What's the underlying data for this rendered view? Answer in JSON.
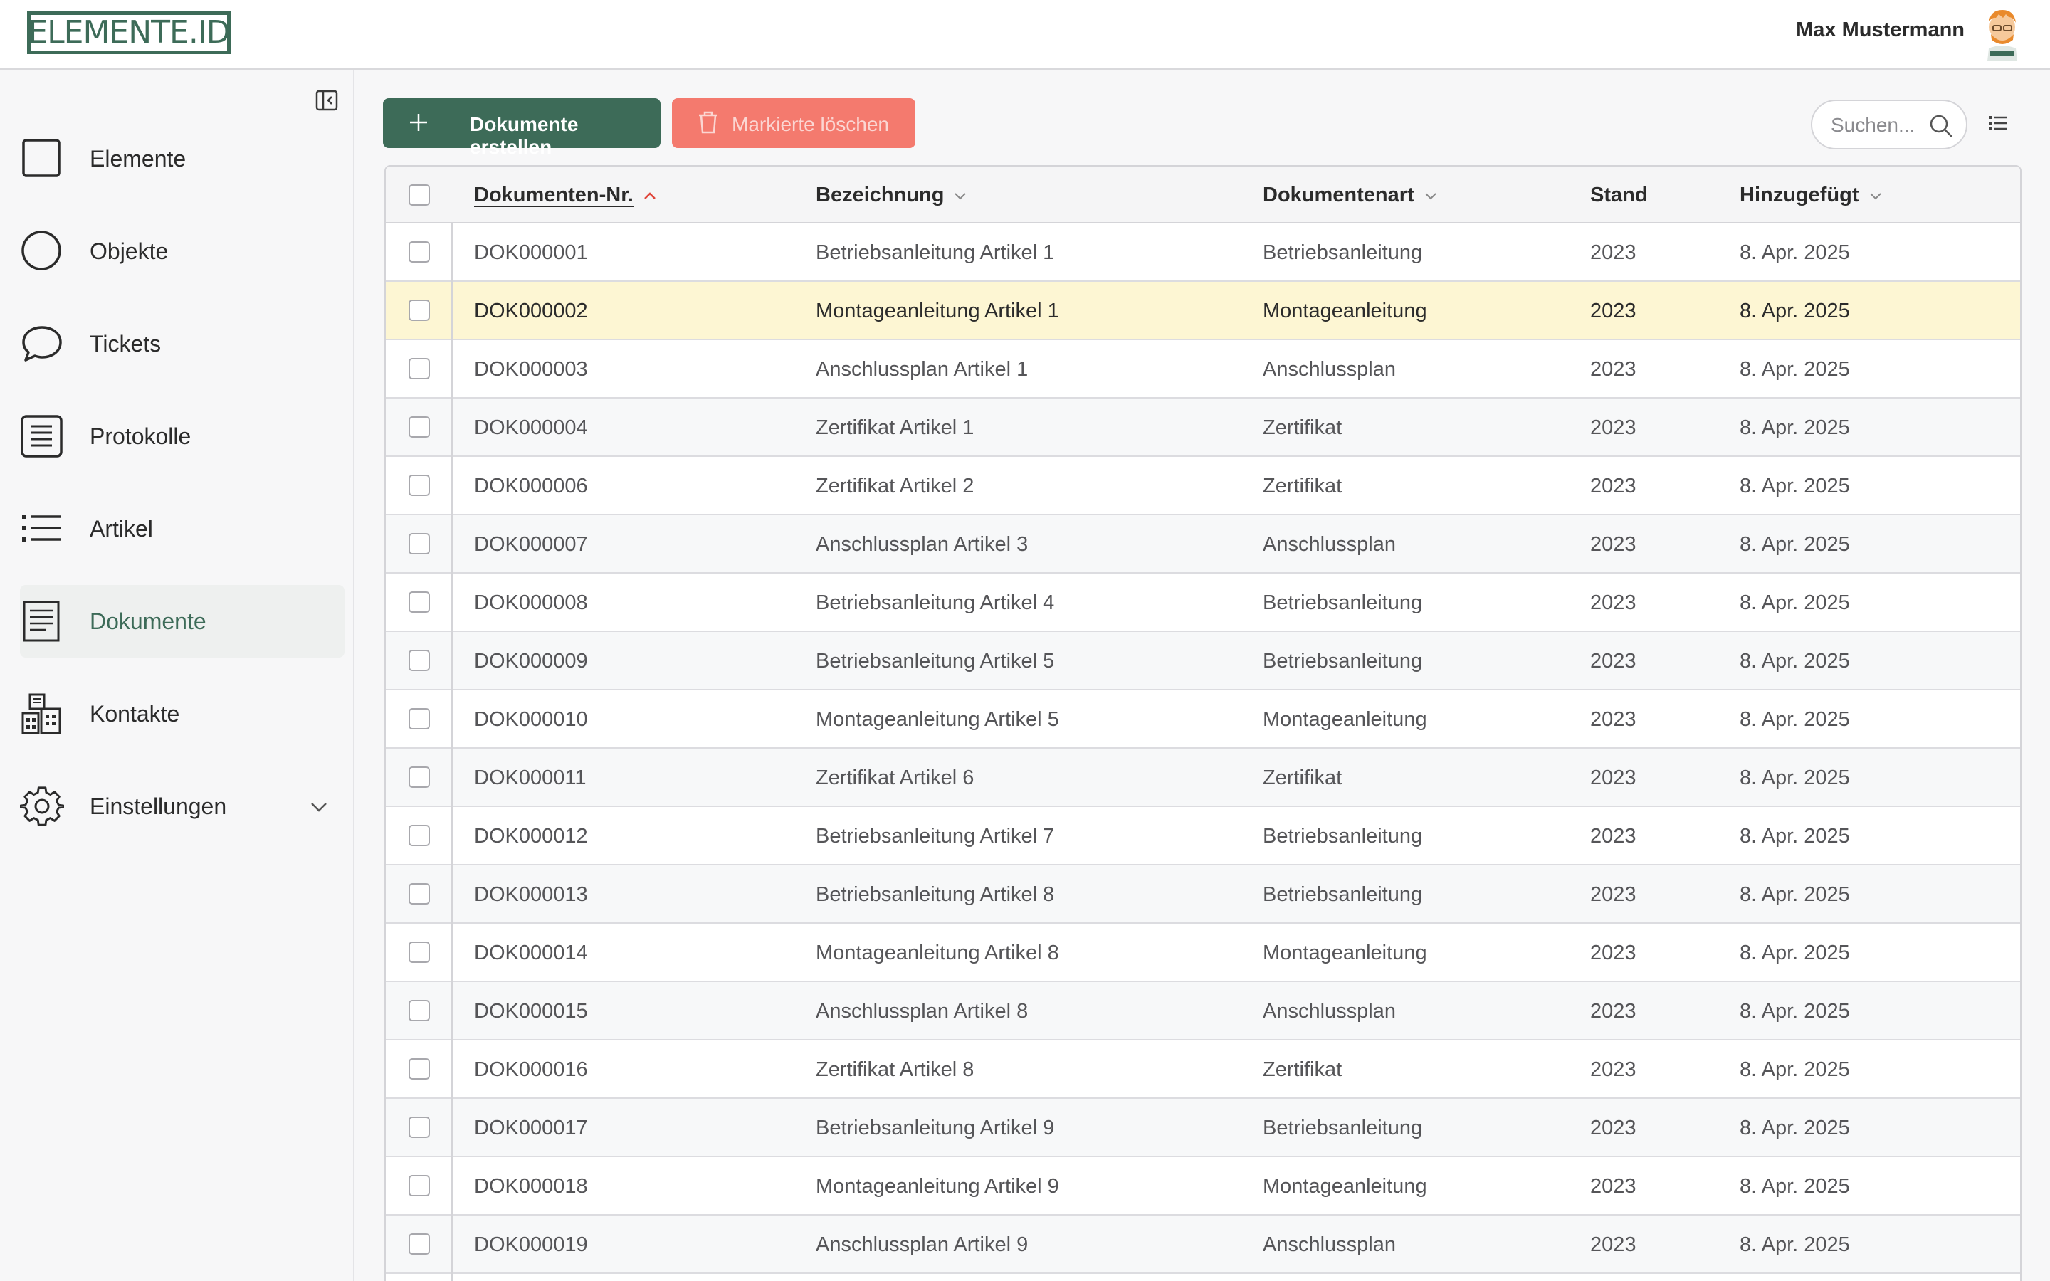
{
  "header": {
    "logo_text": "ELEMENTE.ID",
    "user_name": "Max Mustermann"
  },
  "sidebar": {
    "items": [
      {
        "label": "Elemente",
        "icon": "square-icon",
        "active": false
      },
      {
        "label": "Objekte",
        "icon": "circle-icon",
        "active": false
      },
      {
        "label": "Tickets",
        "icon": "chat-bubble-icon",
        "active": false
      },
      {
        "label": "Protokolle",
        "icon": "document-lines-icon",
        "active": false
      },
      {
        "label": "Artikel",
        "icon": "list-icon",
        "active": false
      },
      {
        "label": "Dokumente",
        "icon": "document-icon",
        "active": true
      },
      {
        "label": "Kontakte",
        "icon": "buildings-icon",
        "active": false
      },
      {
        "label": "Einstellungen",
        "icon": "gear-icon",
        "active": false,
        "expandable": true
      }
    ]
  },
  "toolbar": {
    "create_label": "Dokumente erstellen",
    "delete_label": "Markierte löschen",
    "search_placeholder": "Suchen..."
  },
  "table": {
    "columns": [
      "Dokumenten-Nr.",
      "Bezeichnung",
      "Dokumentenart",
      "Stand",
      "Hinzugefügt"
    ],
    "sorted_column": "Dokumenten-Nr.",
    "sort_direction": "asc",
    "highlighted_row": 1,
    "rows": [
      [
        "DOK000001",
        "Betriebsanleitung Artikel 1",
        "Betriebsanleitung",
        "2023",
        "8. Apr. 2025"
      ],
      [
        "DOK000002",
        "Montageanleitung Artikel 1",
        "Montageanleitung",
        "2023",
        "8. Apr. 2025"
      ],
      [
        "DOK000003",
        "Anschlussplan Artikel 1",
        "Anschlussplan",
        "2023",
        "8. Apr. 2025"
      ],
      [
        "DOK000004",
        "Zertifikat Artikel 1",
        "Zertifikat",
        "2023",
        "8. Apr. 2025"
      ],
      [
        "DOK000006",
        "Zertifikat Artikel 2",
        "Zertifikat",
        "2023",
        "8. Apr. 2025"
      ],
      [
        "DOK000007",
        "Anschlussplan Artikel 3",
        "Anschlussplan",
        "2023",
        "8. Apr. 2025"
      ],
      [
        "DOK000008",
        "Betriebsanleitung Artikel 4",
        "Betriebsanleitung",
        "2023",
        "8. Apr. 2025"
      ],
      [
        "DOK000009",
        "Betriebsanleitung Artikel 5",
        "Betriebsanleitung",
        "2023",
        "8. Apr. 2025"
      ],
      [
        "DOK000010",
        "Montageanleitung Artikel 5",
        "Montageanleitung",
        "2023",
        "8. Apr. 2025"
      ],
      [
        "DOK000011",
        "Zertifikat Artikel 6",
        "Zertifikat",
        "2023",
        "8. Apr. 2025"
      ],
      [
        "DOK000012",
        "Betriebsanleitung Artikel 7",
        "Betriebsanleitung",
        "2023",
        "8. Apr. 2025"
      ],
      [
        "DOK000013",
        "Betriebsanleitung Artikel 8",
        "Betriebsanleitung",
        "2023",
        "8. Apr. 2025"
      ],
      [
        "DOK000014",
        "Montageanleitung Artikel 8",
        "Montageanleitung",
        "2023",
        "8. Apr. 2025"
      ],
      [
        "DOK000015",
        "Anschlussplan Artikel 8",
        "Anschlussplan",
        "2023",
        "8. Apr. 2025"
      ],
      [
        "DOK000016",
        "Zertifikat Artikel 8",
        "Zertifikat",
        "2023",
        "8. Apr. 2025"
      ],
      [
        "DOK000017",
        "Betriebsanleitung Artikel 9",
        "Betriebsanleitung",
        "2023",
        "8. Apr. 2025"
      ],
      [
        "DOK000018",
        "Montageanleitung Artikel 9",
        "Montageanleitung",
        "2023",
        "8. Apr. 2025"
      ],
      [
        "DOK000019",
        "Anschlussplan Artikel 9",
        "Anschlussplan",
        "2023",
        "8. Apr. 2025"
      ]
    ]
  },
  "colors": {
    "brand": "#3d6b58",
    "danger": "#f47a6e",
    "highlight_row": "#fdf6d3",
    "sort_arrow": "#e0453a"
  }
}
